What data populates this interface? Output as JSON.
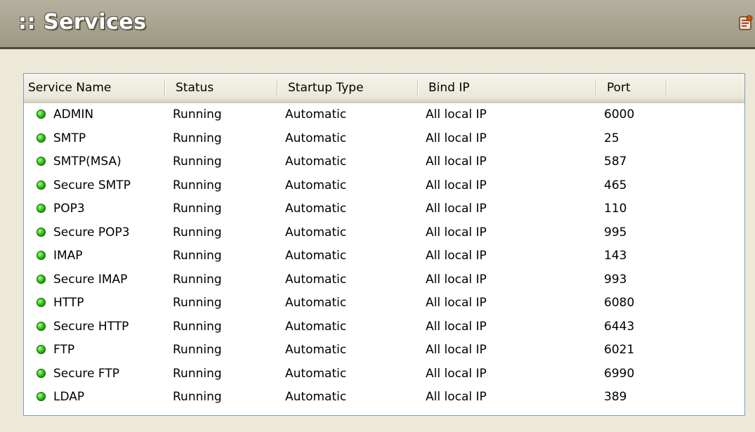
{
  "header": {
    "title": ":: Services",
    "icon": "settings-icon"
  },
  "columns": [
    {
      "label": "Service Name"
    },
    {
      "label": "Status"
    },
    {
      "label": "Startup Type"
    },
    {
      "label": "Bind IP"
    },
    {
      "label": "Port"
    }
  ],
  "status_color": "#2fbf16",
  "services": [
    {
      "name": "ADMIN",
      "status": "Running",
      "startup": "Automatic",
      "bind_ip": "All local IP",
      "port": "6000"
    },
    {
      "name": "SMTP",
      "status": "Running",
      "startup": "Automatic",
      "bind_ip": "All local IP",
      "port": "25"
    },
    {
      "name": "SMTP(MSA)",
      "status": "Running",
      "startup": "Automatic",
      "bind_ip": "All local IP",
      "port": "587"
    },
    {
      "name": "Secure SMTP",
      "status": "Running",
      "startup": "Automatic",
      "bind_ip": "All local IP",
      "port": "465"
    },
    {
      "name": "POP3",
      "status": "Running",
      "startup": "Automatic",
      "bind_ip": "All local IP",
      "port": "110"
    },
    {
      "name": "Secure POP3",
      "status": "Running",
      "startup": "Automatic",
      "bind_ip": "All local IP",
      "port": "995"
    },
    {
      "name": "IMAP",
      "status": "Running",
      "startup": "Automatic",
      "bind_ip": "All local IP",
      "port": "143"
    },
    {
      "name": "Secure IMAP",
      "status": "Running",
      "startup": "Automatic",
      "bind_ip": "All local IP",
      "port": "993"
    },
    {
      "name": "HTTP",
      "status": "Running",
      "startup": "Automatic",
      "bind_ip": "All local IP",
      "port": "6080"
    },
    {
      "name": "Secure HTTP",
      "status": "Running",
      "startup": "Automatic",
      "bind_ip": "All local IP",
      "port": "6443"
    },
    {
      "name": "FTP",
      "status": "Running",
      "startup": "Automatic",
      "bind_ip": "All local IP",
      "port": "6021"
    },
    {
      "name": "Secure FTP",
      "status": "Running",
      "startup": "Automatic",
      "bind_ip": "All local IP",
      "port": "6990"
    },
    {
      "name": "LDAP",
      "status": "Running",
      "startup": "Automatic",
      "bind_ip": "All local IP",
      "port": "389"
    }
  ]
}
